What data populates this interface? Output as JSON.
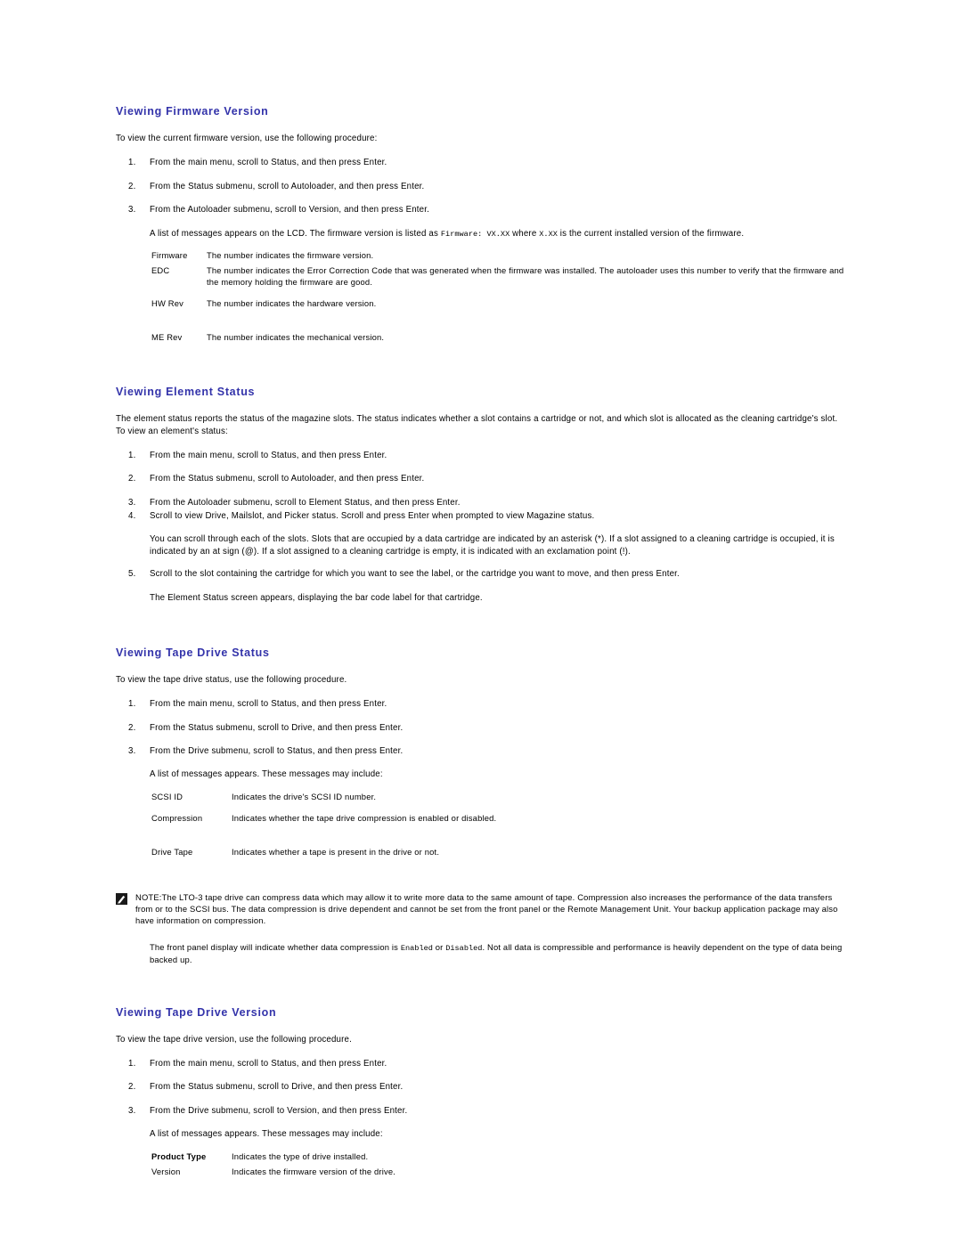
{
  "sections": [
    {
      "heading": "Viewing Firmware Version",
      "intro": "To view the current firmware version, use the following procedure:",
      "steps": [
        {
          "num": "1.",
          "text": "From the main menu, scroll to Status, and then press Enter."
        },
        {
          "num": "2.",
          "text": "From the Status submenu, scroll to Autoloader, and then press Enter."
        },
        {
          "num": "3.",
          "text": "From the Autoloader submenu, scroll to Version, and then press Enter."
        }
      ],
      "after_steps": {
        "prefix": "A list of messages appears on the LCD. The firmware version is listed as ",
        "mono1": "Firmware: VX.XX",
        "middle": " where ",
        "mono2": "X.XX",
        "suffix": " is the current installed version of the firmware."
      },
      "definitions": [
        {
          "term": "Firmware",
          "desc": "The number indicates the firmware version."
        },
        {
          "term": "EDC",
          "desc": "The number indicates the Error Correction Code that was generated when the firmware was installed. The autoloader uses this number to verify that the firmware and the memory holding the firmware are good."
        },
        {
          "term": "HW Rev",
          "desc": "The number indicates the hardware version."
        },
        {
          "term": "ME Rev",
          "desc": "The number indicates the mechanical version."
        }
      ]
    },
    {
      "heading": "Viewing Element Status",
      "intro": "The element status reports the status of the magazine slots. The status indicates whether a slot contains a cartridge or not, and which slot is allocated as the cleaning cartridge's slot. To view an element's status:",
      "steps": [
        {
          "num": "1.",
          "text": "From the main menu, scroll to Status, and then press Enter."
        },
        {
          "num": "2.",
          "text": "From the Status submenu, scroll to Autoloader, and then press Enter."
        },
        {
          "num": "3.",
          "text": "From the Autoloader submenu, scroll to Element Status, and then press Enter."
        },
        {
          "num": "4.",
          "text": "Scroll to view Drive, Mailslot, and Picker status. Scroll and press Enter when prompted to view Magazine status."
        }
      ],
      "note_para": "You can scroll through each of the slots. Slots that are occupied by a data cartridge are indicated by an asterisk (*). If a slot assigned to a cleaning cartridge is occupied, it is indicated by an at sign (@). If a slot assigned to a cleaning cartridge is empty, it is indicated with an exclamation point (!).",
      "step5": {
        "num": "5.",
        "text": "Scroll to the slot containing the cartridge for which you want to see the label, or the cartridge you want to move, and then press Enter."
      },
      "closing": "The Element Status screen appears, displaying the bar code label for that cartridge."
    },
    {
      "heading": "Viewing Tape Drive Status",
      "intro": "To view the tape drive status, use the following procedure.",
      "steps": [
        {
          "num": "1.",
          "text": "From the main menu, scroll to Status, and then press Enter."
        },
        {
          "num": "2.",
          "text": "From the Status submenu, scroll to Drive, and then press Enter."
        },
        {
          "num": "3.",
          "text": "From the Drive submenu, scroll to Status, and then press Enter."
        }
      ],
      "after_steps_plain": "A list of messages appears. These messages may include:",
      "definitions": [
        {
          "term": "SCSI ID",
          "desc": "Indicates the drive's SCSI ID number."
        },
        {
          "term": "Compression",
          "desc": "Indicates whether the tape drive compression is enabled or disabled."
        },
        {
          "term": "Drive Tape",
          "desc": "Indicates whether a tape is present in the drive or not."
        }
      ]
    },
    {
      "heading": "Viewing Tape Drive Version",
      "intro": "To view the tape drive version, use the following procedure.",
      "steps": [
        {
          "num": "1.",
          "text": "From the main menu, scroll to Status, and then press Enter."
        },
        {
          "num": "2.",
          "text": "From the Status submenu, scroll to Drive, and then press Enter."
        },
        {
          "num": "3.",
          "text": "From the Drive submenu, scroll to Version, and then press Enter."
        }
      ],
      "after_steps_plain": "A list of messages appears. These messages may include:",
      "definitions": [
        {
          "term": "Product Type",
          "desc": "Indicates the type of drive installed.",
          "bold": true
        },
        {
          "term": "Version",
          "desc": "Indicates the firmware version of the drive."
        }
      ]
    }
  ],
  "note": {
    "icon": "note-pencil-icon",
    "body": "NOTE:The LTO-3 tape drive can compress data which may allow it to write more data to the same amount of tape. Compression also increases the performance of the data transfers from or to the SCSI bus. The data compression is drive dependent and cannot be set from the front panel or the Remote Management Unit. Your backup application package may also have information on compression.",
    "second_prefix": "The front panel display will indicate whether data compression is ",
    "second_mono1": "Enabled",
    "second_middle": " or ",
    "second_mono2": "Disabled",
    "second_suffix": ". Not all data is compressible and performance is heavily dependent on the type of data being backed up."
  },
  "colors": {
    "heading": "#3333AA",
    "text": "#000000",
    "background": "#ffffff"
  }
}
